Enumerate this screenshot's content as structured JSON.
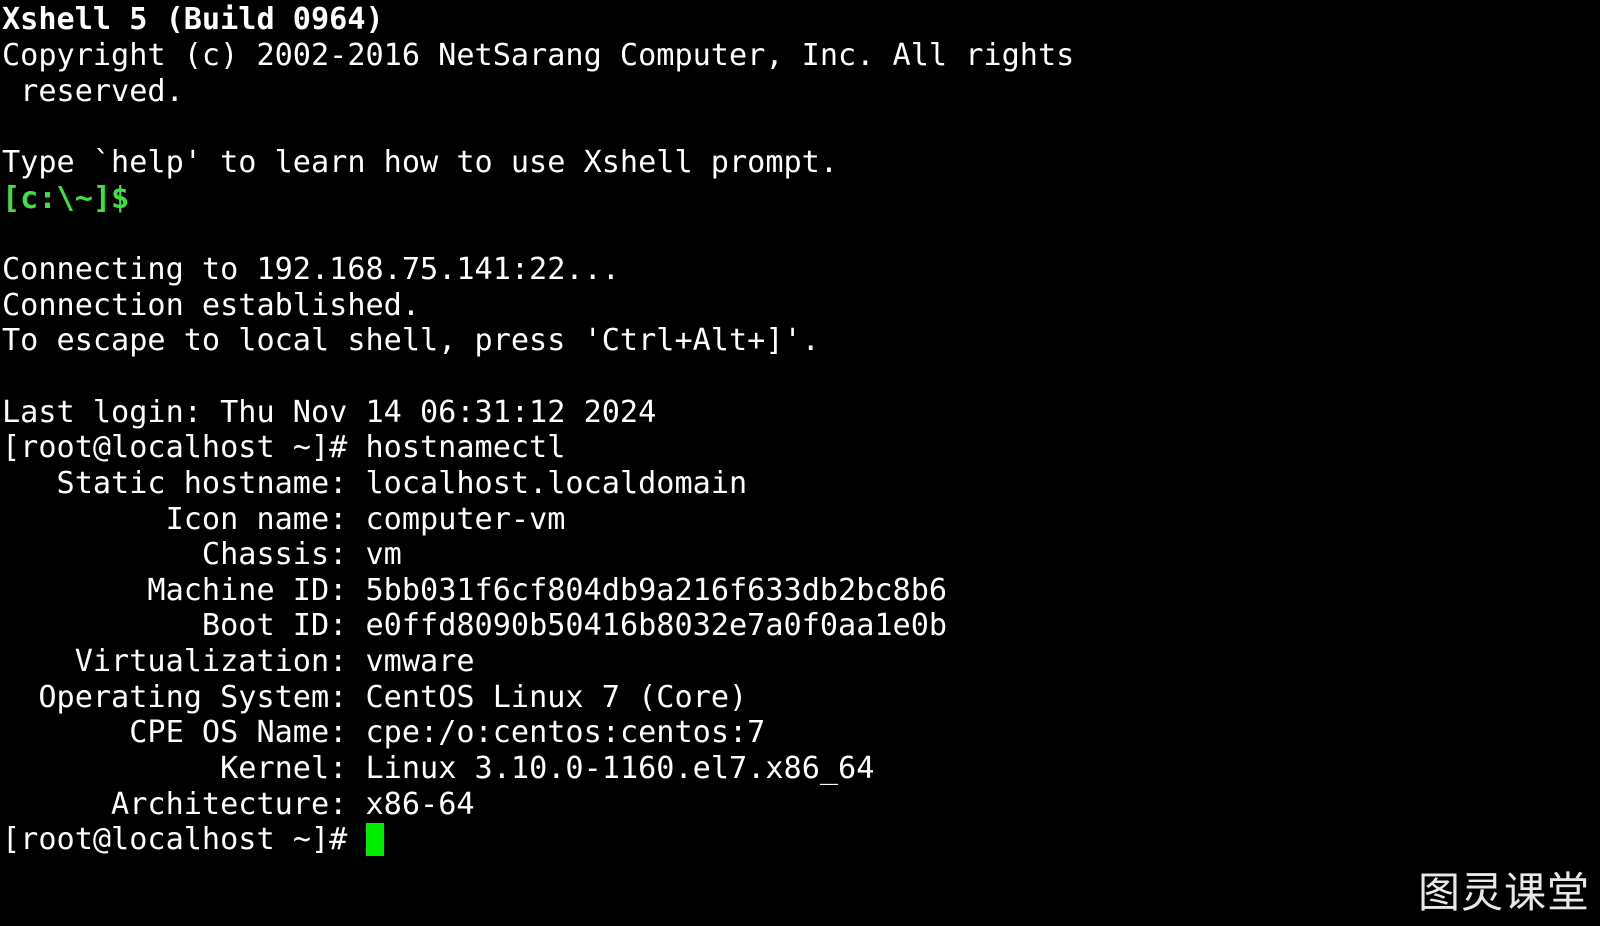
{
  "terminal": {
    "title_line": "Xshell 5 (Build 0964)",
    "copyright_line1": "Copyright (c) 2002-2016 NetSarang Computer, Inc. All rights",
    "copyright_line2": " reserved.",
    "help_line": "Type `help' to learn how to use Xshell prompt.",
    "local_prompt": "[c:\\~]$",
    "connecting": "Connecting to 192.168.75.141:22...",
    "established": "Connection established.",
    "escape_hint": "To escape to local shell, press 'Ctrl+Alt+]'.",
    "last_login": "Last login: Thu Nov 14 06:31:12 2024",
    "command_line": "[root@localhost ~]# hostnamectl",
    "hostnamectl": [
      {
        "label": "   Static hostname:",
        "value": " localhost.localdomain"
      },
      {
        "label": "         Icon name:",
        "value": " computer-vm"
      },
      {
        "label": "           Chassis:",
        "value": " vm"
      },
      {
        "label": "        Machine ID:",
        "value": " 5bb031f6cf804db9a216f633db2bc8b6"
      },
      {
        "label": "           Boot ID:",
        "value": " e0ffd8090b50416b8032e7a0f0aa1e0b"
      },
      {
        "label": "    Virtualization:",
        "value": " vmware"
      },
      {
        "label": "  Operating System:",
        "value": " CentOS Linux 7 (Core)"
      },
      {
        "label": "       CPE OS Name:",
        "value": " cpe:/o:centos:centos:7"
      },
      {
        "label": "            Kernel:",
        "value": " Linux 3.10.0-1160.el7.x86_64"
      },
      {
        "label": "      Architecture:",
        "value": " x86-64"
      }
    ],
    "final_prompt": "[root@localhost ~]# ",
    "cursor_color": "#00ee00",
    "prompt_color": "#3fe03f"
  },
  "watermark": "图灵课堂"
}
